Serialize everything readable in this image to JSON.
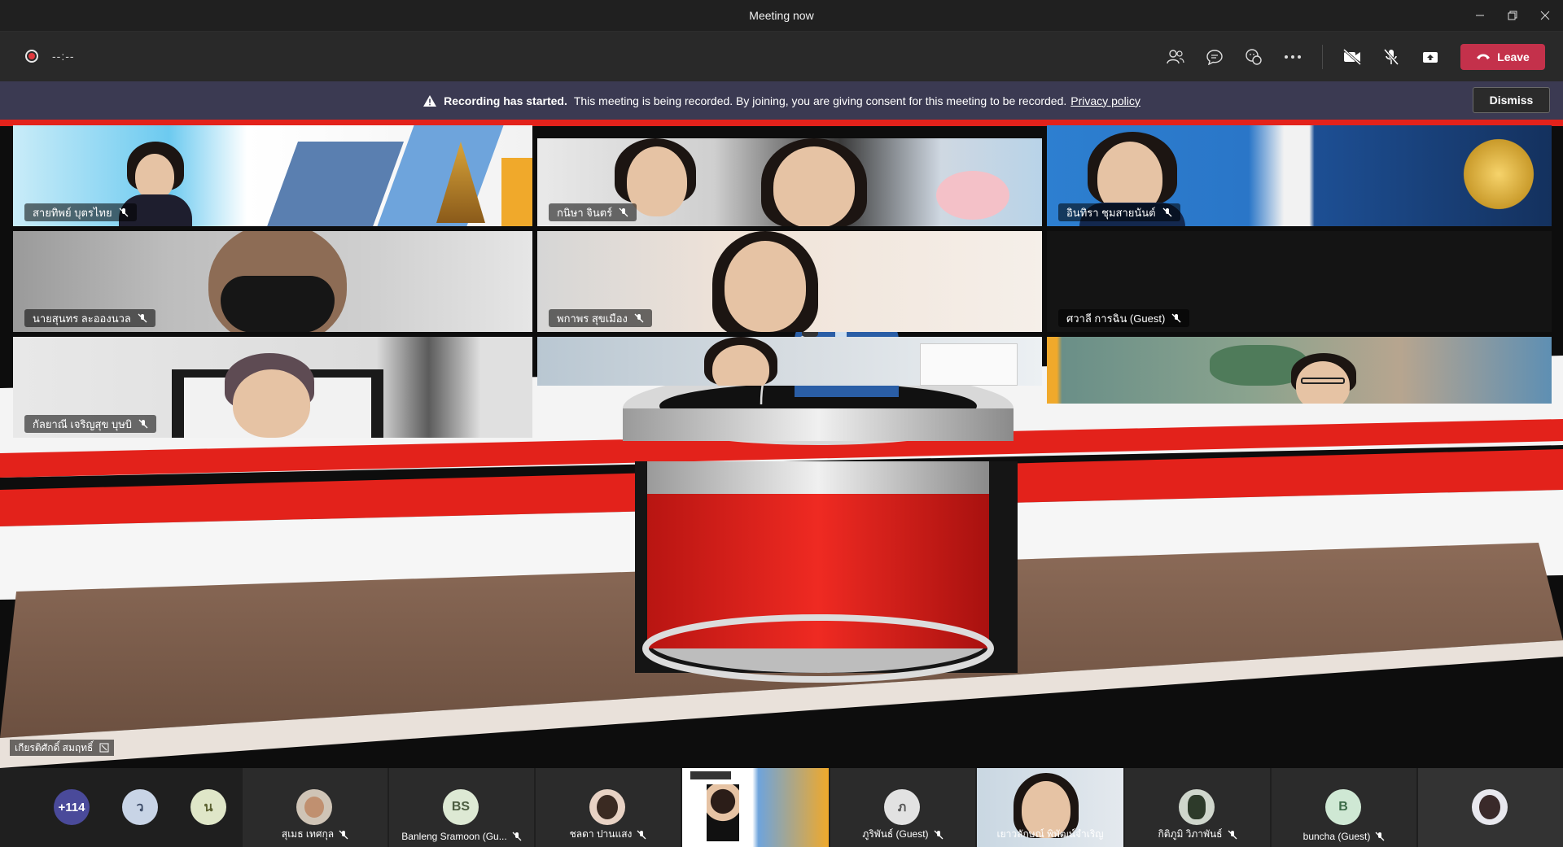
{
  "window": {
    "title": "Meeting now"
  },
  "toolbar": {
    "timer": "--:--",
    "leave_label": "Leave"
  },
  "banner": {
    "bold": "Recording has started.",
    "text": "This meeting is being recorded. By joining, you are giving consent for this meeting to be recorded.",
    "link": "Privacy policy",
    "dismiss": "Dismiss"
  },
  "grid": [
    {
      "name": "สายทิพย์ บุตรไทย"
    },
    {
      "name": "กนิษา จินตร์"
    },
    {
      "name": "อินทิรา ชุมสายนันต์"
    },
    {
      "name": "นายสุนทร ละอองนวล"
    },
    {
      "name": "พกาพร สุขเมือง"
    },
    {
      "name": "ศวาลี การฉิน (Guest)"
    },
    {
      "name": "กัลยาณี เจริญสุข บุษบิ"
    }
  ],
  "host_label": "เกียรติศักดิ์ สมฤทธิ์",
  "bottom_bar": {
    "overflow": "+114",
    "initial_a": "ว",
    "initial_b": "น",
    "participants": [
      {
        "name": "สุเมธ เทศกุล"
      },
      {
        "name": "Banleng Sramoon (Gu...",
        "initials": "BS"
      },
      {
        "name": "ชลดา ปานแสง"
      },
      {
        "name": "ภูริพันธ์ (Guest)",
        "initials": "ภ"
      },
      {
        "name": "เยาวลักษณ์ พิพัฒน์จำเริญ"
      },
      {
        "name": "กิติภูมิ วิภาพันธ์"
      },
      {
        "name": "buncha (Guest)",
        "initials": "B"
      }
    ]
  },
  "colors": {
    "leave": "#c4314b",
    "banner": "#3b3a52",
    "accent_red": "#e3221b"
  }
}
